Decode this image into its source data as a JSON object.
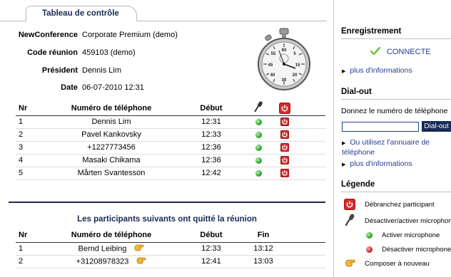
{
  "tab": {
    "label": "Tableau de contrôle"
  },
  "info": [
    {
      "label": "NewConference",
      "value": "Corporate Premium (demo)"
    },
    {
      "label": "Code réunion",
      "value": "459103 (demo)"
    },
    {
      "label": "Président",
      "value": "Dennis Lim"
    },
    {
      "label": "Date",
      "value": "06-07-2010 12:31"
    }
  ],
  "active": {
    "headers": {
      "nr": "Nr",
      "phone": "Numéro de téléphone",
      "start": "Début"
    },
    "rows": [
      {
        "nr": "1",
        "phone": "Dennis Lim",
        "start": "12:31"
      },
      {
        "nr": "2",
        "phone": "Pavel Kankovsky",
        "start": "12:33"
      },
      {
        "nr": "3",
        "phone": "+1227773456",
        "start": "12:36"
      },
      {
        "nr": "4",
        "phone": "Masaki Chikama",
        "start": "12:36"
      },
      {
        "nr": "5",
        "phone": "Mårten Svantesson",
        "start": "12:42"
      }
    ]
  },
  "left": {
    "title": "Les participants suivants ont quitté la réunion",
    "headers": {
      "nr": "Nr",
      "phone": "Numéro de téléphone",
      "start": "Début",
      "end": "Fin"
    },
    "rows": [
      {
        "nr": "1",
        "phone": "Bernd Leibing",
        "start": "12:33",
        "end": "13:12"
      },
      {
        "nr": "2",
        "phone": "+31208978323",
        "start": "12:41",
        "end": "13:03"
      }
    ]
  },
  "panel": {
    "recording": {
      "title": "Enregistrement",
      "status": "CONNECTE",
      "more": "plus d'informations"
    },
    "dialout": {
      "title": "Dial-out",
      "prompt": "Donnez le numéro de téléphone",
      "input_value": "",
      "button": "Dial-out",
      "directory": "Ou utilisez l'annuaire de téléphone",
      "more": "plus d'informations"
    },
    "legend": {
      "title": "Légende",
      "items": [
        {
          "icon": "power-icon",
          "label": "Débranchez participant"
        },
        {
          "icon": "microphone-icon",
          "label": "Désactiver/activer microphone"
        },
        {
          "icon": "green-dot-icon",
          "label": "Activer microphone"
        },
        {
          "icon": "red-dot-icon",
          "label": "Désactiver microphone"
        },
        {
          "icon": "redial-hand-icon",
          "label": "Composer à nouveau"
        }
      ]
    }
  },
  "colors": {
    "navy": "#1a2a55",
    "link": "#1f3f8f",
    "power_red": "#d62b2b",
    "green": "#2fa62b",
    "check_green": "#6fc63a"
  }
}
